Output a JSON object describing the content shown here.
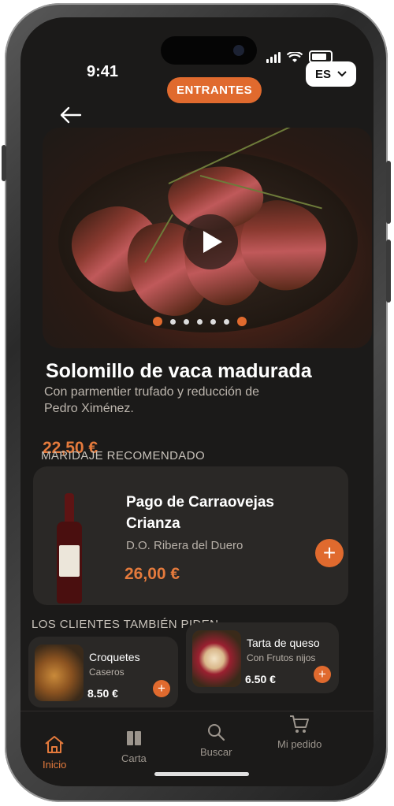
{
  "status": {
    "time": "9:41"
  },
  "header": {
    "category": "ENTRANTES",
    "language": "ES"
  },
  "dish": {
    "title": "Solomillo de vaca madurada",
    "description": "Con parmentier trufado y reducción de Pedro Ximénez.",
    "price": "22,50 €"
  },
  "pairing": {
    "section_label": "MARIDAJE RECOMENDADO",
    "name_line1": "Pago de Carraovejas",
    "name_line2": "Crianza",
    "origin": "D.O. Ribera del Duero",
    "price": "26,00 €"
  },
  "also": {
    "section_label": "LOS CLIENTES TAMBIÉN PIDEN",
    "items": [
      {
        "name": "Croquetes",
        "sub": "Caseros",
        "price": "8.50 €"
      },
      {
        "name": "Tarta de queso",
        "sub": "Con Frutos nijos",
        "price": "6.50 €"
      }
    ]
  },
  "tabs": [
    {
      "label": "Inicio",
      "icon": "home-icon",
      "active": true
    },
    {
      "label": "Carta",
      "icon": "book-icon"
    },
    {
      "label": "Buscar",
      "icon": "search-icon"
    },
    {
      "label": "Mi pedido",
      "icon": "cart-icon"
    }
  ],
  "colors": {
    "accent": "#e06a2e",
    "background": "#1b1a19",
    "card": "#2a2826"
  }
}
